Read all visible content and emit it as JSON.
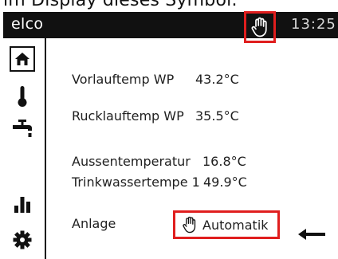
{
  "caption": "im Display dieses Symbol.",
  "header": {
    "brand": "elco",
    "manual_icon": "hand-icon",
    "time": "13:25"
  },
  "sidebar": {
    "items": [
      {
        "icon": "home-icon",
        "selected": true
      },
      {
        "icon": "thermometer-icon",
        "selected": false
      },
      {
        "icon": "water-tap-icon",
        "selected": false
      },
      {
        "icon": "bar-chart-icon",
        "selected": false
      },
      {
        "icon": "gear-icon",
        "selected": false
      }
    ]
  },
  "rows": [
    {
      "label": "Vorlauftemp WP",
      "value": "43.2°C"
    },
    {
      "label": "Rucklauftemp WP",
      "value": "35.5°C"
    },
    {
      "label": "Aussentemperatur",
      "value": "16.8°C"
    },
    {
      "label": "Trinkwassertempe 1",
      "value": "49.9°C"
    }
  ],
  "anlage": {
    "label": "Anlage",
    "mode_icon": "hand-icon",
    "value": "Automatik"
  },
  "colors": {
    "header_bg": "#111111",
    "highlight": "#e01e1e"
  },
  "annotation_icon": "arrow-left-icon"
}
